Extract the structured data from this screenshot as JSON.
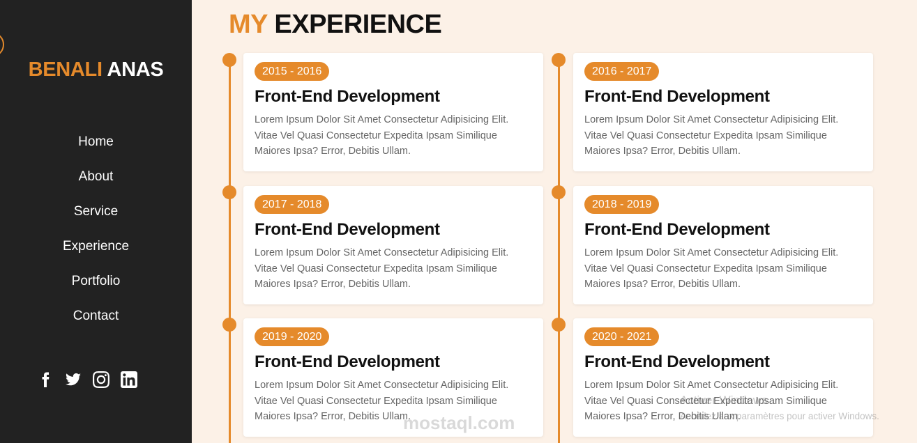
{
  "sidebar": {
    "brand_first": "BENALI",
    "brand_last": "ANAS",
    "nav": [
      "Home",
      "About",
      "Service",
      "Experience",
      "Portfolio",
      "Contact"
    ],
    "socials": [
      "facebook-icon",
      "twitter-icon",
      "instagram-icon",
      "linkedin-icon"
    ]
  },
  "heading": {
    "accent": "MY",
    "rest": "EXPERIENCE"
  },
  "cards": [
    {
      "years": "2015 - 2016",
      "title": "Front-End Development",
      "desc": "Lorem Ipsum Dolor Sit Amet Consectetur Adipisicing Elit. Vitae Vel Quasi Consectetur Expedita Ipsam Similique Maiores Ipsa? Error, Debitis Ullam."
    },
    {
      "years": "2016 - 2017",
      "title": "Front-End Development",
      "desc": "Lorem Ipsum Dolor Sit Amet Consectetur Adipisicing Elit. Vitae Vel Quasi Consectetur Expedita Ipsam Similique Maiores Ipsa? Error, Debitis Ullam."
    },
    {
      "years": "2017 - 2018",
      "title": "Front-End Development",
      "desc": "Lorem Ipsum Dolor Sit Amet Consectetur Adipisicing Elit. Vitae Vel Quasi Consectetur Expedita Ipsam Similique Maiores Ipsa? Error, Debitis Ullam."
    },
    {
      "years": "2018 - 2019",
      "title": "Front-End Development",
      "desc": "Lorem Ipsum Dolor Sit Amet Consectetur Adipisicing Elit. Vitae Vel Quasi Consectetur Expedita Ipsam Similique Maiores Ipsa? Error, Debitis Ullam."
    },
    {
      "years": "2019 - 2020",
      "title": "Front-End Development",
      "desc": "Lorem Ipsum Dolor Sit Amet Consectetur Adipisicing Elit. Vitae Vel Quasi Consectetur Expedita Ipsam Similique Maiores Ipsa? Error, Debitis Ullam."
    },
    {
      "years": "2020 - 2021",
      "title": "Front-End Development",
      "desc": "Lorem Ipsum Dolor Sit Amet Consectetur Adipisicing Elit. Vitae Vel Quasi Consectetur Expedita Ipsam Similique Maiores Ipsa? Error, Debitis Ullam."
    }
  ],
  "colors": {
    "accent": "#e58a2b",
    "sidebar_bg": "#222222",
    "page_bg": "#fcf1e7"
  },
  "overlay": {
    "watermark": "mostaql.com",
    "activate_title": "Activer Windows",
    "activate_sub": "Accédez aux paramètres pour activer Windows."
  }
}
